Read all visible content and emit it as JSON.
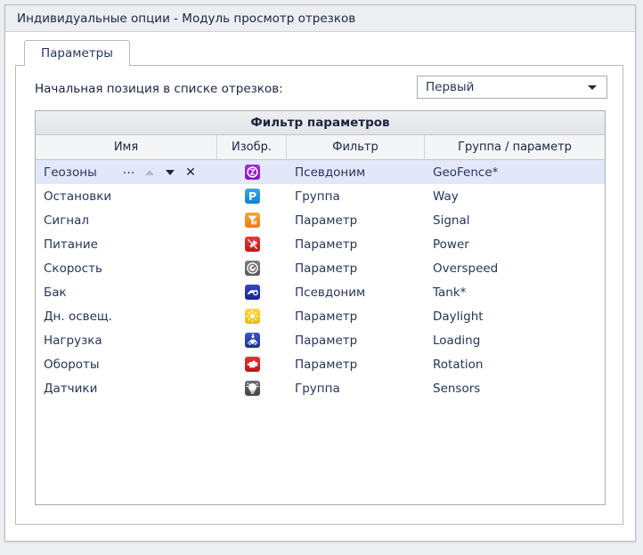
{
  "dialog": {
    "title": "Индивидуальные опции - Модуль просмотр отрезков"
  },
  "tabs": [
    {
      "label": "Параметры"
    }
  ],
  "start_position": {
    "label": "Начальная позиция в списке отрезков:",
    "value": "Первый",
    "arrow_icon": "chevron-down-icon"
  },
  "table": {
    "group_header": "Фильтр параметров",
    "columns": [
      {
        "key": "name",
        "label": "Имя"
      },
      {
        "key": "image",
        "label": "Изобр."
      },
      {
        "key": "filter",
        "label": "Фильтр"
      },
      {
        "key": "group",
        "label": "Группа / параметр"
      }
    ],
    "row_actions": {
      "more": "…",
      "move_up": "▲",
      "move_down": "▼",
      "remove": "✕"
    },
    "rows": [
      {
        "name": "Геозоны",
        "icon": "geofence-icon",
        "filter": "Псевдоним",
        "group": "GeoFence*",
        "selected": true
      },
      {
        "name": "Остановки",
        "icon": "parking-icon",
        "filter": "Группа",
        "group": "Way",
        "selected": false
      },
      {
        "name": "Сигнал",
        "icon": "signal-icon",
        "filter": "Параметр",
        "group": "Signal",
        "selected": false
      },
      {
        "name": "Питание",
        "icon": "power-icon",
        "filter": "Параметр",
        "group": "Power",
        "selected": false
      },
      {
        "name": "Скорость",
        "icon": "speed-icon",
        "filter": "Параметр",
        "group": "Overspeed",
        "selected": false
      },
      {
        "name": "Бак",
        "icon": "tank-icon",
        "filter": "Псевдоним",
        "group": "Tank*",
        "selected": false
      },
      {
        "name": "Дн. освещ.",
        "icon": "daylight-icon",
        "filter": "Параметр",
        "group": "Daylight",
        "selected": false
      },
      {
        "name": "Нагрузка",
        "icon": "loading-icon",
        "filter": "Параметр",
        "group": "Loading",
        "selected": false
      },
      {
        "name": "Обороты",
        "icon": "rotation-icon",
        "filter": "Параметр",
        "group": "Rotation",
        "selected": false
      },
      {
        "name": "Датчики",
        "icon": "sensors-icon",
        "filter": "Группа",
        "group": "Sensors",
        "selected": false
      }
    ]
  },
  "colors": {
    "window_bg": "#eceef1",
    "panel_bg": "#ffffff",
    "text": "#27355c",
    "selection": "#e2e8fa",
    "border": "#b6bac0"
  }
}
